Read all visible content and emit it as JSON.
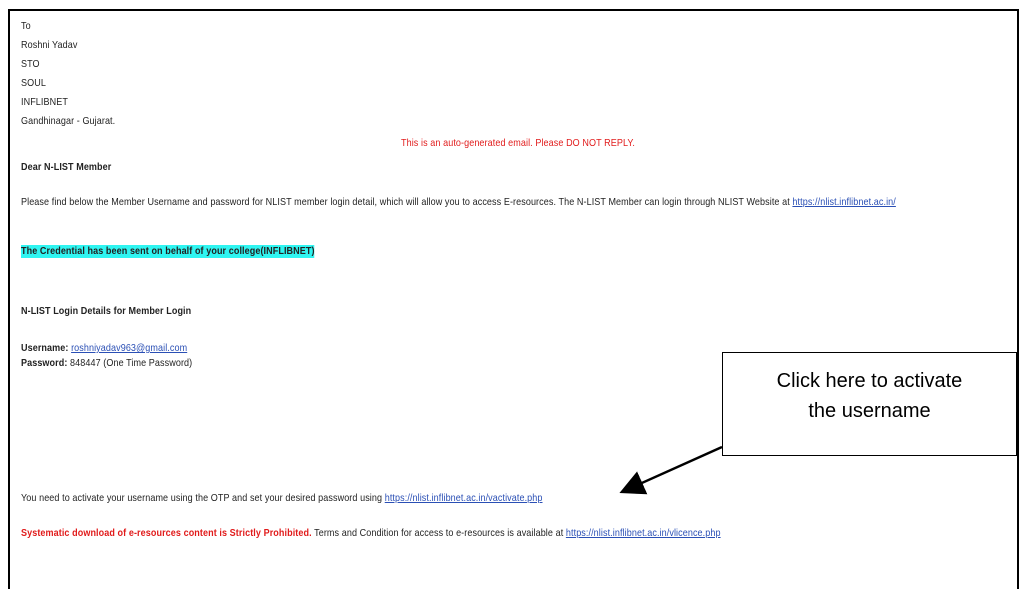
{
  "address": {
    "to": "To",
    "name": "Roshni Yadav",
    "designation": "STO",
    "department": "SOUL",
    "organization": "INFLIBNET",
    "city": "Gandhinagar - Gujarat."
  },
  "notice": "This is an auto-generated email. Please DO NOT REPLY.",
  "greeting": "Dear N-LIST Member",
  "intro": {
    "text": "Please find below the Member Username and password for NLIST member login detail, which will allow you to access E-resources. The N-LIST Member can login through NLIST Website at ",
    "link": "https://nlist.inflibnet.ac.in/"
  },
  "credential_note": "The Credential has been sent on behalf of your college(INFLIBNET)",
  "login_heading": "N-LIST Login Details for Member Login",
  "username": {
    "label": "Username:",
    "value": "roshniyadav963@gmail.com"
  },
  "password": {
    "label": "Password:",
    "value": "848447 (One Time Password)"
  },
  "activate": {
    "text": "You need to activate your username using the OTP and set your desired password using ",
    "link": "https://nlist.inflibnet.ac.in/vactivate.php"
  },
  "prohibited": {
    "warning": "Systematic download of e-resources content is Strictly Prohibited.",
    "text": " Terms and Condition for access to e-resources is available at ",
    "link": "https://nlist.inflibnet.ac.in/vlicence.php"
  },
  "callout": {
    "line1": "Click here to activate",
    "line2": "the username"
  }
}
